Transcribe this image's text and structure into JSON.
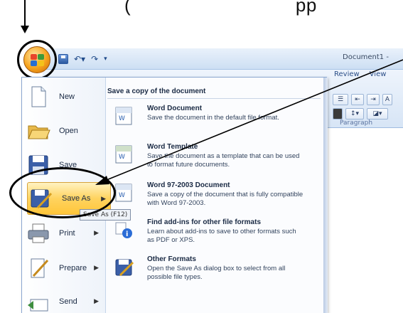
{
  "caption": {
    "text": "(                              pp"
  },
  "window": {
    "doc_title": "Document1 -",
    "ribbon_tabs": [
      "Review",
      "View"
    ],
    "group_label": "Paragraph"
  },
  "office_menu": {
    "left_items": [
      {
        "label": "New",
        "has_submenu": false
      },
      {
        "label": "Open",
        "has_submenu": false
      },
      {
        "label": "Save",
        "has_submenu": false
      },
      {
        "label": "Save As",
        "has_submenu": true,
        "active": true
      },
      {
        "label": "Print",
        "has_submenu": true
      },
      {
        "label": "Prepare",
        "has_submenu": true
      },
      {
        "label": "Send",
        "has_submenu": true
      }
    ],
    "tooltip": "Save As (F12)",
    "panel_header": "Save a copy of the document",
    "options": [
      {
        "title": "Word Document",
        "desc": "Save the document in the default file format."
      },
      {
        "title": "Word Template",
        "desc": "Save the document as a template that can be used to format future documents."
      },
      {
        "title": "Word 97-2003 Document",
        "desc": "Save a copy of the document that is fully compatible with Word 97-2003."
      },
      {
        "title": "Find add-ins for other file formats",
        "desc": "Learn about add-ins to save to other formats such as PDF or XPS."
      },
      {
        "title": "Other Formats",
        "desc": "Open the Save As dialog box to select from all possible file types."
      }
    ]
  },
  "icons": {
    "office_button": "office-logo-icon",
    "qat": [
      "save-icon",
      "undo-icon",
      "redo-icon",
      "customize-icon"
    ],
    "arrow": "pointer-arrow-icon"
  },
  "colors": {
    "accent": "#ffc63a",
    "menu_border": "#8ba7d0",
    "ribbon": "#d7e5f6"
  }
}
